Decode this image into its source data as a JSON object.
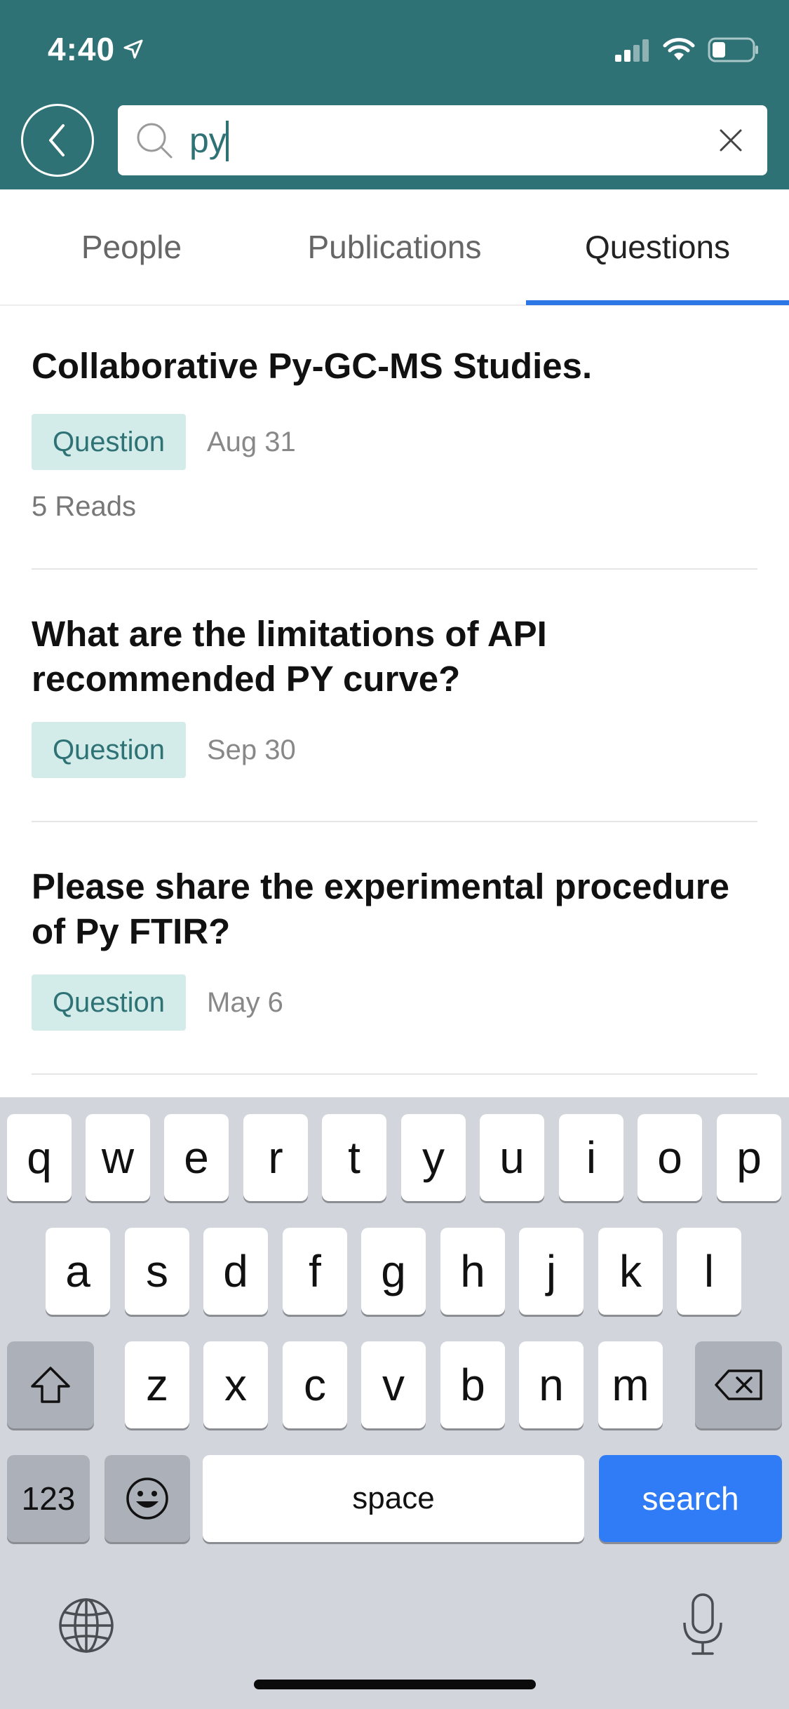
{
  "status_bar": {
    "time": "4:40"
  },
  "search": {
    "value": "py"
  },
  "tabs": [
    {
      "label": "People"
    },
    {
      "label": "Publications"
    },
    {
      "label": "Questions"
    }
  ],
  "results": [
    {
      "title": "Collaborative Py-GC-MS Studies.",
      "badge": "Question",
      "date": "Aug 31",
      "reads": "5 Reads"
    },
    {
      "title": "What are the limitations of API recommended PY curve?",
      "badge": "Question",
      "date": "Sep 30"
    },
    {
      "title": "Please share the experimental procedure of Py  FTIR?",
      "badge": "Question",
      "date": "May 6"
    }
  ],
  "keyboard": {
    "row1": [
      "q",
      "w",
      "e",
      "r",
      "t",
      "y",
      "u",
      "i",
      "o",
      "p"
    ],
    "row2": [
      "a",
      "s",
      "d",
      "f",
      "g",
      "h",
      "j",
      "k",
      "l"
    ],
    "row3": [
      "z",
      "x",
      "c",
      "v",
      "b",
      "n",
      "m"
    ],
    "numbers_label": "123",
    "space_label": "space",
    "search_label": "search"
  },
  "colors": {
    "header": "#2f7275",
    "accent": "#2d76e6",
    "badge_bg": "#d3ecea",
    "search_key": "#2f7cf6"
  },
  "icons": [
    "location-arrow-icon",
    "signal-icon",
    "wifi-icon",
    "battery-icon",
    "back-icon",
    "search-icon",
    "clear-icon",
    "shift-icon",
    "delete-icon",
    "emoji-icon",
    "globe-icon",
    "microphone-icon"
  ]
}
